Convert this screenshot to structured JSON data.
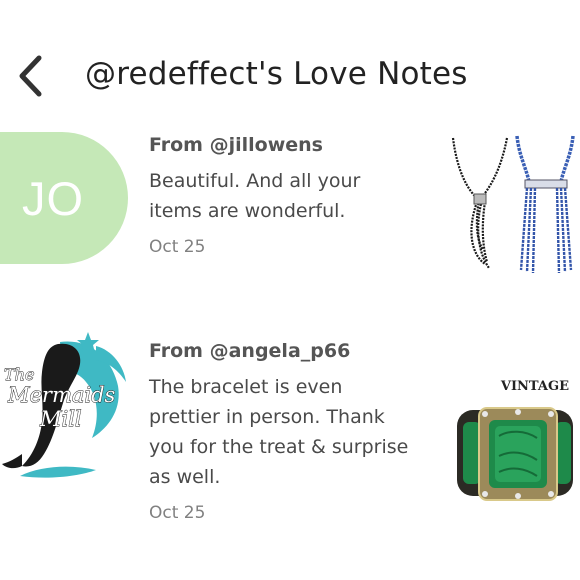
{
  "header": {
    "title": "@redeffect's Love Notes"
  },
  "notes": [
    {
      "from": "From @jillowens",
      "avatar_initials": "JO",
      "message": "Beautiful. And all your items are wonderful.",
      "date": "Oct 25"
    },
    {
      "from": "From @angela_p66",
      "avatar_logo_text": [
        "The",
        "Mermaids",
        "Mill"
      ],
      "message": "The bracelet is even prettier in person. Thank you for the treat & surprise as well.",
      "date": "Oct 25",
      "thumb_label": "VINTAGE"
    }
  ],
  "colors": {
    "avatar_green": "#c5e8b7",
    "mermaid_teal": "#3fb9c4",
    "malachite_green": "#1e8a4a"
  },
  "icons": {
    "back": "chevron-left-icon"
  }
}
